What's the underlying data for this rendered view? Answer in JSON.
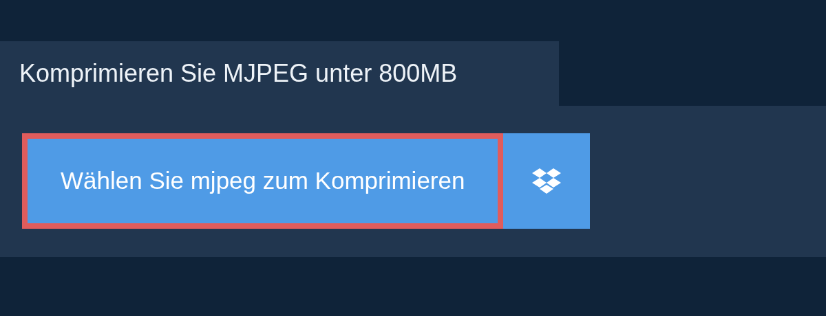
{
  "tab": {
    "label": "Komprimieren Sie MJPEG unter 800MB"
  },
  "buttons": [
    {
      "kind": "text",
      "label": "Wählen Sie mjpeg zum Komprimieren",
      "focused": true
    },
    {
      "kind": "icon",
      "focused": false
    }
  ]
}
